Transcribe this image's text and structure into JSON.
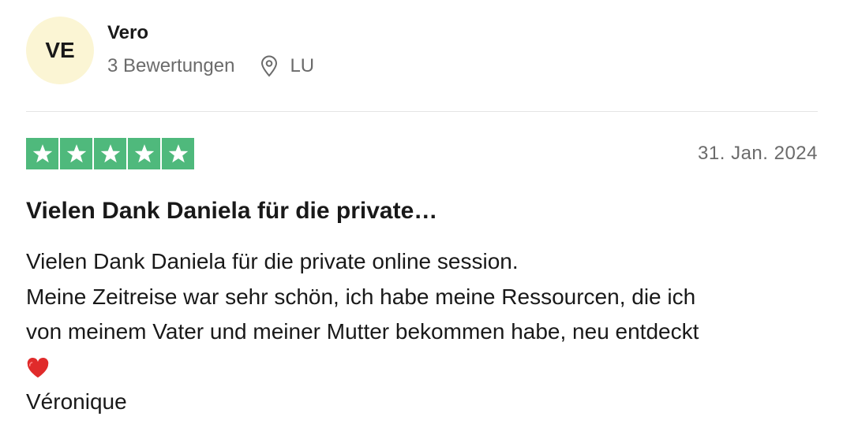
{
  "reviewer": {
    "initials": "VE",
    "name": "Vero",
    "reviews_count": "3 Bewertungen",
    "location": "LU",
    "avatar_color": "#fbf5d4"
  },
  "review": {
    "rating": 5,
    "max_rating": 5,
    "star_color": "#4fb97c",
    "date": "31. Jan. 2024",
    "title": "Vielen Dank Daniela für die private…",
    "body_lines": [
      "Vielen Dank Daniela für die private online session.",
      "Meine Zeitreise war sehr schön, ich habe meine Ressourcen, die ich",
      "von meinem Vater und meiner Mutter bekommen habe, neu entdeckt"
    ],
    "heart_icon": "red-heart-icon",
    "signature": "Véronique"
  }
}
